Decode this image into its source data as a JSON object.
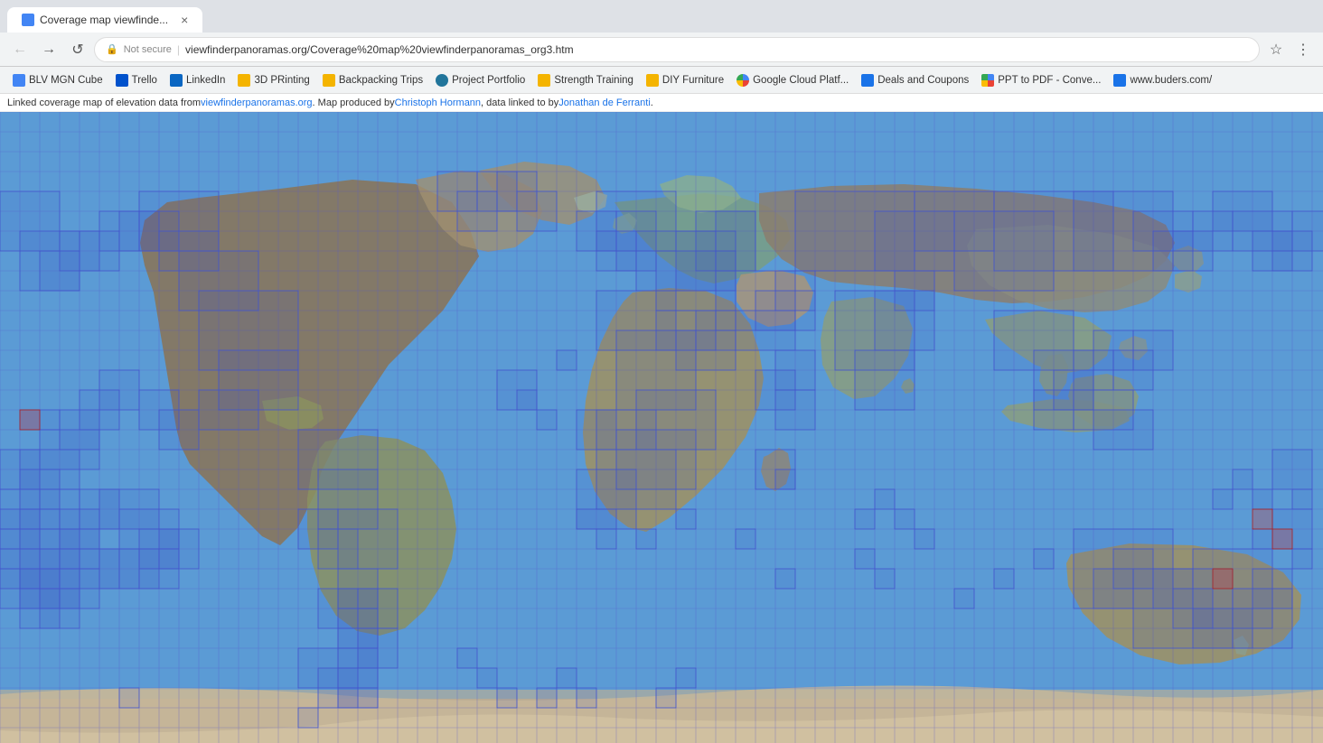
{
  "browser": {
    "tab_title": "Coverage map viewfinderpanoramas",
    "url_display": "viewfinderpanoramas.org/Coverage%20map%20viewfinderpanoramas_org3.htm",
    "security_label": "Not secure",
    "back_btn": "←",
    "forward_btn": "→",
    "reload_btn": "↺"
  },
  "bookmarks": [
    {
      "id": "blv",
      "label": "BLV MGN Cube",
      "icon_class": "bm-blue"
    },
    {
      "id": "trello",
      "label": "Trello",
      "icon_class": "bm-blue"
    },
    {
      "id": "linkedin",
      "label": "LinkedIn",
      "icon_class": "bm-blue-li"
    },
    {
      "id": "3dp",
      "label": "3D PRinting",
      "icon_class": "bm-yellow"
    },
    {
      "id": "backpacking",
      "label": "Backpacking Trips",
      "icon_class": "bm-yellow"
    },
    {
      "id": "portfolio",
      "label": "Project Portfolio",
      "icon_class": "bm-wp"
    },
    {
      "id": "strength",
      "label": "Strength Training",
      "icon_class": "bm-yellow"
    },
    {
      "id": "diy",
      "label": "DIY Furniture",
      "icon_class": "bm-yellow"
    },
    {
      "id": "gcloud",
      "label": "Google Cloud Platf...",
      "icon_class": "bm-google"
    },
    {
      "id": "deals",
      "label": "Deals and Coupons",
      "icon_class": "bm-gg"
    },
    {
      "id": "ppt",
      "label": "PPT to PDF - Conve...",
      "icon_class": "bm-google"
    },
    {
      "id": "buders",
      "label": "www.buders.com/",
      "icon_class": "bm-gg"
    }
  ],
  "info_bar": {
    "text": "Linked coverage map of elevation data from ",
    "link1": "viewfinderpanoramas.org",
    "middle": ". Map produced by ",
    "link2": "Christoph Hormann",
    "end": ", data linked to by ",
    "link3": "Jonathan de Ferranti",
    "period": "."
  }
}
